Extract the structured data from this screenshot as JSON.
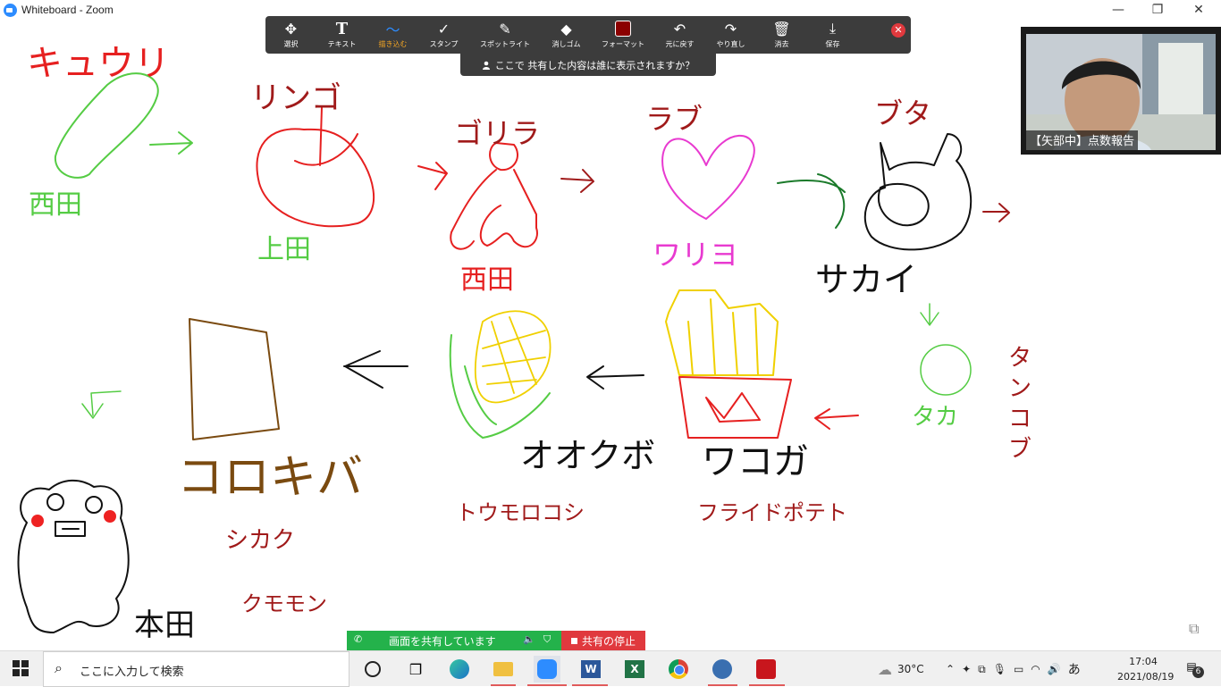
{
  "window": {
    "title": "Whiteboard - Zoom",
    "minimize": "—",
    "maximize": "❐",
    "close": "✕"
  },
  "toolbar": {
    "tools": [
      {
        "label": "選択",
        "icon": "move-icon"
      },
      {
        "label": "テキスト",
        "icon": "text-icon"
      },
      {
        "label": "描き込む",
        "icon": "draw-icon",
        "active": true
      },
      {
        "label": "スタンプ",
        "icon": "stamp-icon"
      },
      {
        "label": "スポットライト",
        "icon": "spotlight-icon"
      },
      {
        "label": "消しゴム",
        "icon": "eraser-icon"
      },
      {
        "label": "フォーマット",
        "icon": "format-icon"
      },
      {
        "label": "元に戻す",
        "icon": "undo-icon"
      },
      {
        "label": "やり直し",
        "icon": "redo-icon"
      },
      {
        "label": "消去",
        "icon": "trash-icon"
      },
      {
        "label": "保存",
        "icon": "save-icon"
      }
    ],
    "format_color": "#8b0000",
    "banner": "ここで 共有した内容は誰に表示されますか？"
  },
  "video": {
    "participant_name": "【矢部中】点数報告"
  },
  "whiteboard": {
    "words": {
      "kyuuri": "キュウリ",
      "nishida1": "西田",
      "ringo": "リンゴ",
      "ueda": "上田",
      "gorira": "ゴリラ",
      "nishida2": "西田",
      "rabu": "ラブ",
      "wariyo": "ワリヨ",
      "buta": "ブタ",
      "sakai": "サカイ",
      "tanko": "タンコブ",
      "taka": "タカ",
      "wakoga": "ワコガ",
      "fry": "フライドポテト",
      "ookuabo": "オオクボ",
      "tomorokoshi": "トウモロコシ",
      "kopoki": "コロキバ",
      "shikaku": "シカク",
      "kumomon": "クモモン",
      "honda": "本田"
    }
  },
  "sharing": {
    "status": "画面を共有しています",
    "stop": "共有の停止"
  },
  "taskbar": {
    "search_placeholder": "ここに入力して検索",
    "weather": "30°C",
    "ime": "あ",
    "time": "17:04",
    "date": "2021/08/19",
    "notifications": "6"
  },
  "colors": {
    "green": "#55cc44",
    "red": "#e62020",
    "darkred": "#8b1a1a",
    "pink": "#e83ad0",
    "brown": "#7a4a10",
    "yellow": "#f0d000",
    "black": "#111111"
  }
}
